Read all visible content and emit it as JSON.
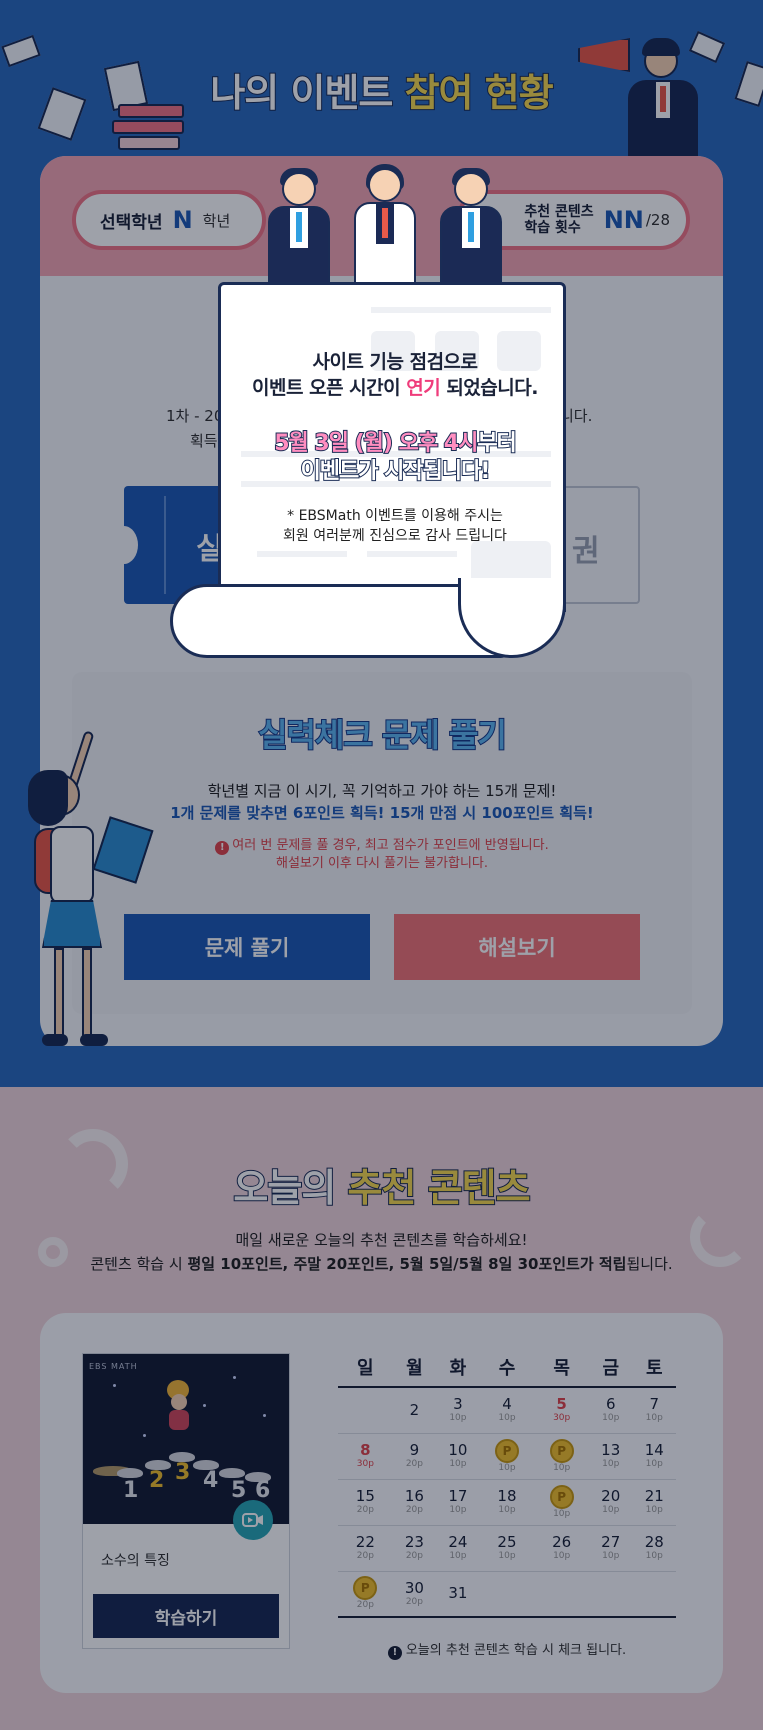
{
  "event_status": {
    "title_white": "나의 이벤트",
    "title_yellow": "참여 현황",
    "grade": {
      "label": "선택학년",
      "value": "N",
      "unit": "학년"
    },
    "recommend_count": {
      "label_line1": "추천 콘텐츠",
      "label_line2": "학습 횟수",
      "value": "NN",
      "total": "/28"
    },
    "intro_line1": "1차 - 20",
    "intro_line1_end": "니다.",
    "intro_line2": "획득",
    "ticket_left_text": "실",
    "ticket_right_text": "권"
  },
  "skill_check": {
    "title": "실력체크 문제 풀기",
    "desc_line1": "학년별 지금 이 시기, 꼭 기억하고 가야 하는 15개 문제!",
    "desc_line2": "1개 문제를 맞추면 6포인트 획득! 15개 만점 시 100포인트 획득!",
    "warn_icon": "!",
    "warn_line1": "여러 번 문제를 풀 경우, 최고 점수가 포인트에 반영됩니다.",
    "warn_line2": "해설보기 이후 다시 풀기는 불가합니다.",
    "solve_button": "문제 풀기",
    "answer_button": "해설보기"
  },
  "recommend": {
    "title_white": "오늘의",
    "title_yellow": "추천 콘텐츠",
    "desc_line1": "매일 새로운 오늘의 추천 콘텐츠를 학습하세요!",
    "desc_line2_pre": "콘텐츠 학습 시 ",
    "desc_line2_bold": "평일 10포인트, 주말 20포인트, 5월 5일/5월 8일 30포인트가 적립",
    "desc_line2_post": "됩니다.",
    "content_logo": "EBS MATH",
    "content_digits": [
      "1",
      "2",
      "3",
      "4",
      "5",
      "6"
    ],
    "content_name": "소수의 특징",
    "study_button": "학습하기",
    "calendar_note_icon": "!",
    "calendar_note": "오늘의 추천 콘텐츠 학습 시 체크 됩니다."
  },
  "calendar": {
    "weekdays": [
      "일",
      "월",
      "화",
      "수",
      "목",
      "금",
      "토"
    ],
    "weeks": [
      [
        {
          "day": "",
          "pts": ""
        },
        {
          "day": "2",
          "pts": ""
        },
        {
          "day": "3",
          "pts": "10p"
        },
        {
          "day": "4",
          "pts": "10p"
        },
        {
          "day": "5",
          "pts": "30p",
          "red": true
        },
        {
          "day": "6",
          "pts": "10p"
        },
        {
          "day": "7",
          "pts": "10p"
        }
      ],
      [
        {
          "day": "8",
          "pts": "30p",
          "red": true
        },
        {
          "day": "9",
          "pts": "20p"
        },
        {
          "day": "10",
          "pts": "10p"
        },
        {
          "day": "P",
          "pts": "10p",
          "coin": true
        },
        {
          "day": "P",
          "pts": "10p",
          "coin": true
        },
        {
          "day": "13",
          "pts": "10p"
        },
        {
          "day": "14",
          "pts": "10p"
        }
      ],
      [
        {
          "day": "15",
          "pts": "20p"
        },
        {
          "day": "16",
          "pts": "20p"
        },
        {
          "day": "17",
          "pts": "10p"
        },
        {
          "day": "18",
          "pts": "10p"
        },
        {
          "day": "P",
          "pts": "10p",
          "coin": true
        },
        {
          "day": "20",
          "pts": "10p"
        },
        {
          "day": "21",
          "pts": "10p"
        }
      ],
      [
        {
          "day": "22",
          "pts": "20p"
        },
        {
          "day": "23",
          "pts": "20p"
        },
        {
          "day": "24",
          "pts": "10p"
        },
        {
          "day": "25",
          "pts": "10p"
        },
        {
          "day": "26",
          "pts": "10p"
        },
        {
          "day": "27",
          "pts": "10p"
        },
        {
          "day": "28",
          "pts": "10p"
        }
      ],
      [
        {
          "day": "P",
          "pts": "20p",
          "coin": true
        },
        {
          "day": "30",
          "pts": "20p"
        },
        {
          "day": "31",
          "pts": ""
        },
        {
          "day": "",
          "pts": ""
        },
        {
          "day": "",
          "pts": ""
        },
        {
          "day": "",
          "pts": ""
        },
        {
          "day": "",
          "pts": ""
        }
      ]
    ]
  },
  "modal": {
    "line1": "사이트 기능 점검으로",
    "line2_pre": "이벤트 오픈 시간이 ",
    "line2_pink": "연기",
    "line2_post": " 되었습니다.",
    "line3_pink": "5월 3일 (월) 오후 4시",
    "line3_white": "부터",
    "line4": "이벤트가 시작됩니다!",
    "line5": "* EBSMath 이벤트를 이용해 주시는",
    "line6": "회원 여러분께 진심으로 감사 드립니다"
  },
  "colors": {
    "top_bg": "#2d6bbd",
    "accent_blue": "#1f5bb5",
    "accent_red": "#f07478",
    "pink_band": "#f4a6b3",
    "title_yellow": "#f7da52",
    "modal_pink": "#ef3c7b",
    "coin": "#f2c12e"
  }
}
